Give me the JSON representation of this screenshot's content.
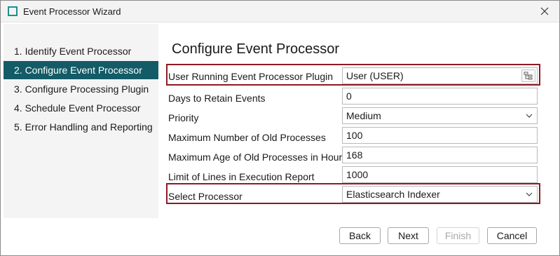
{
  "window": {
    "title": "Event Processor Wizard"
  },
  "steps": [
    {
      "label": "1. Identify Event Processor",
      "active": false
    },
    {
      "label": "2. Configure Event Processor",
      "active": true
    },
    {
      "label": "3. Configure Processing Plugin",
      "active": false
    },
    {
      "label": "4. Schedule Event Processor",
      "active": false
    },
    {
      "label": "5. Error Handling and Reporting",
      "active": false
    }
  ],
  "page": {
    "title": "Configure Event Processor"
  },
  "fields": {
    "user_plugin": {
      "label": "User Running Event Processor Plugin",
      "value": "User (USER)"
    },
    "days_retain": {
      "label": "Days to Retain Events",
      "value": "0"
    },
    "priority": {
      "label": "Priority",
      "value": "Medium"
    },
    "max_old_processes": {
      "label": "Maximum Number of Old Processes",
      "value": "100"
    },
    "max_age_hours": {
      "label": "Maximum Age of Old Processes in Hours",
      "value": "168"
    },
    "limit_lines": {
      "label": "Limit of Lines in Execution Report",
      "value": "1000"
    },
    "select_processor": {
      "label": "Select Processor",
      "value": "Elasticsearch Indexer"
    }
  },
  "buttons": {
    "back": "Back",
    "next": "Next",
    "finish": "Finish",
    "cancel": "Cancel"
  },
  "colors": {
    "active_step": "#135b66",
    "highlight": "#8e1b24",
    "app_icon": "#1d8f8f"
  }
}
